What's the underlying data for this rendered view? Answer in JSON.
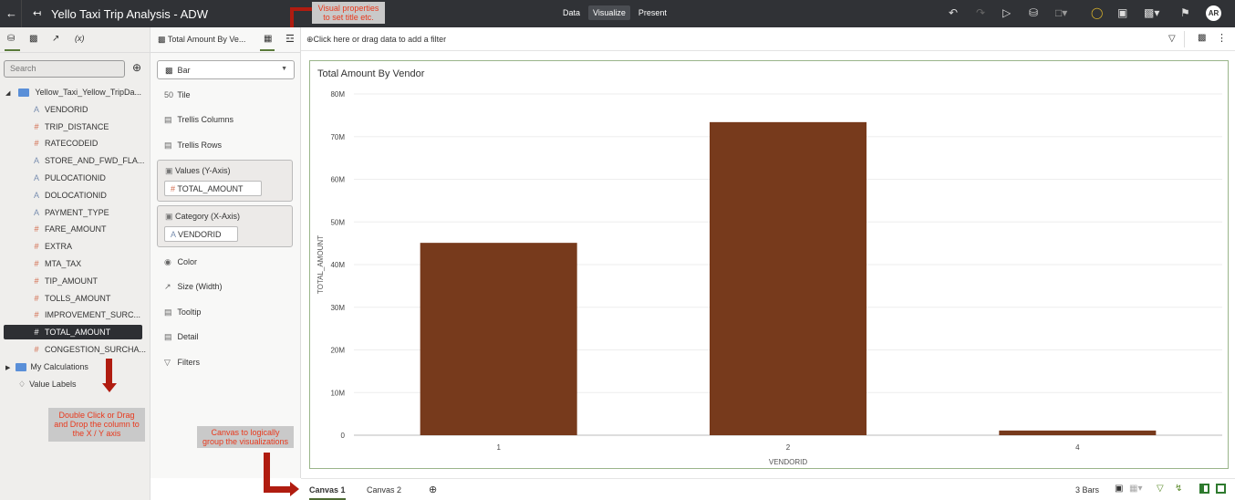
{
  "app": {
    "title": "Yello Taxi Trip Analysis - ADW",
    "modes": [
      "Data",
      "Visualize",
      "Present"
    ],
    "active_mode": "Visualize",
    "avatar": "AR"
  },
  "left_panel": {
    "search_placeholder": "Search",
    "dataset": "Yellow_Taxi_Yellow_TripDa...",
    "fields": [
      {
        "name": "VENDORID",
        "type": "text"
      },
      {
        "name": "TRIP_DISTANCE",
        "type": "number"
      },
      {
        "name": "RATECODEID",
        "type": "number"
      },
      {
        "name": "STORE_AND_FWD_FLA...",
        "type": "text"
      },
      {
        "name": "PULOCATIONID",
        "type": "text"
      },
      {
        "name": "DOLOCATIONID",
        "type": "text"
      },
      {
        "name": "PAYMENT_TYPE",
        "type": "text"
      },
      {
        "name": "FARE_AMOUNT",
        "type": "number"
      },
      {
        "name": "EXTRA",
        "type": "number"
      },
      {
        "name": "MTA_TAX",
        "type": "number"
      },
      {
        "name": "TIP_AMOUNT",
        "type": "number"
      },
      {
        "name": "TOLLS_AMOUNT",
        "type": "number"
      },
      {
        "name": "IMPROVEMENT_SURC...",
        "type": "number"
      },
      {
        "name": "TOTAL_AMOUNT",
        "type": "number",
        "selected": true
      },
      {
        "name": "CONGESTION_SURCHA...",
        "type": "number"
      }
    ],
    "my_calculations": "My Calculations",
    "value_labels": "Value Labels",
    "tab_icons": [
      "database-icon",
      "visualizations-icon",
      "analytics-icon",
      "(x)"
    ]
  },
  "grammar_panel": {
    "viz_tab": "Total Amount By Ve...",
    "chart_type": "Bar",
    "tile": "Tile",
    "trellis_columns": "Trellis Columns",
    "trellis_rows": "Trellis Rows",
    "values_label": "Values (Y-Axis)",
    "values_field": "TOTAL_AMOUNT",
    "category_label": "Category (X-Axis)",
    "category_field": "VENDORID",
    "color": "Color",
    "size": "Size (Width)",
    "tooltip": "Tooltip",
    "detail": "Detail",
    "filters": "Filters"
  },
  "filter_bar": {
    "text": "Click here or drag data to add a filter"
  },
  "chart_data": {
    "type": "bar",
    "title": "Total Amount By Vendor",
    "xlabel": "VENDORID",
    "ylabel": "TOTAL_AMOUNT",
    "categories": [
      "1",
      "2",
      "4"
    ],
    "values": [
      45100000,
      73400000,
      1100000
    ],
    "ylim": [
      0,
      80000000
    ],
    "yticks": [
      "0",
      "10M",
      "20M",
      "30M",
      "40M",
      "50M",
      "60M",
      "70M",
      "80M"
    ],
    "bar_color": "#773a1c",
    "grid": true
  },
  "bottom": {
    "tabs": [
      "Canvas 1",
      "Canvas 2"
    ],
    "active": "Canvas 1",
    "status": "3 Bars"
  },
  "annotations": {
    "visual_props": "Visual properties to set title etc.",
    "drag_hint": "Double Click or Drag and Drop the column to the X / Y axis",
    "canvas_hint": "Canvas to logically group the visualizations"
  }
}
